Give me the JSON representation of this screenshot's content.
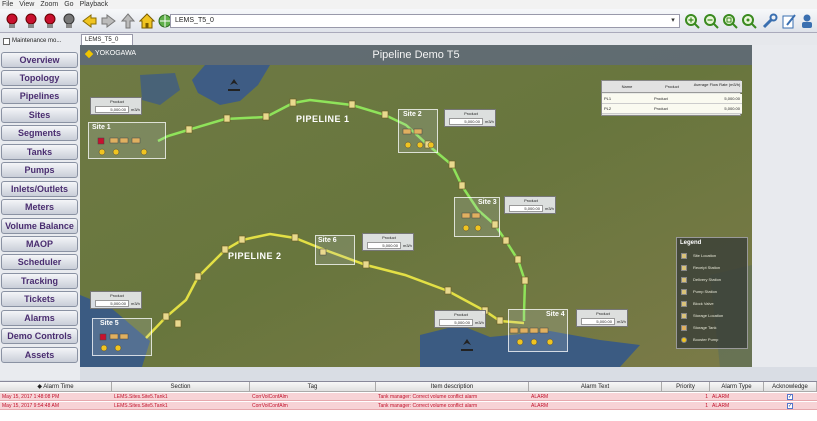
{
  "menu": [
    "File",
    "View",
    "Zoom",
    "Go",
    "Playback"
  ],
  "address": {
    "value": "LEMS_T5_0"
  },
  "tab": {
    "label": "LEMS_T5_0"
  },
  "sidebar": {
    "maintenance_label": "Maintenance mo...",
    "items": [
      "Overview",
      "Topology",
      "Pipelines",
      "Sites",
      "Segments",
      "Tanks",
      "Pumps",
      "Inlets/Outlets",
      "Meters",
      "Volume Balance",
      "MAOP",
      "Scheduler",
      "Tracking",
      "Tickets",
      "Alarms",
      "Demo Controls",
      "Assets"
    ]
  },
  "map": {
    "brand": "YOKOGAWA",
    "title": "Pipeline Demo T5",
    "pipelines": [
      "PIPELINE 1",
      "PIPELINE 2"
    ],
    "sites": [
      "Site 1",
      "Site 2",
      "Site 3",
      "Site 4",
      "Site 5",
      "Site 6"
    ],
    "panels": [
      {
        "label": "Product",
        "value": "5,000.00",
        "unit": "m3/h"
      },
      {
        "label": "Product",
        "value": "5,000.00",
        "unit": "m3/h"
      },
      {
        "label": "Product",
        "value": "5,000.00",
        "unit": "m3/h"
      },
      {
        "label": "Product",
        "value": "5,000.00",
        "unit": "m3/h"
      },
      {
        "label": "Product",
        "value": "5,000.00",
        "unit": "m3/h"
      },
      {
        "label": "Product",
        "value": "5,000.00",
        "unit": "m3/h"
      },
      {
        "label": "Product",
        "value": "5,000.00",
        "unit": "m3/h"
      }
    ],
    "summary": {
      "headers": [
        "Name",
        "Product",
        "Average Flow Rate (m3/h)"
      ],
      "rows": [
        {
          "name": "PL1",
          "product": "Product",
          "rate": "5,000.00"
        },
        {
          "name": "PL2",
          "product": "Product",
          "rate": "5,000.00"
        }
      ]
    },
    "legend": {
      "title": "Legend",
      "items": [
        "Site Location",
        "Receipt Station",
        "Delivery Station",
        "Pump Station",
        "Block Valve",
        "Storage Location",
        "Storage Tank",
        "Booster Pump"
      ]
    }
  },
  "alarms": {
    "headers": [
      "Alarm Time",
      "Section",
      "Tag",
      "Item description",
      "Alarm Text",
      "Priority",
      "Alarm Type",
      "Acknowledge"
    ],
    "rows": [
      {
        "time": "May 15, 2017 1:48:08 PM",
        "section": "LEMS.Sites.Site5.Tank1",
        "tag": "CorrVolConfAlm",
        "desc": "Tank manager: Correct volume conflict alarm",
        "text": "ALARM",
        "priority": "1",
        "type": "ALARM"
      },
      {
        "time": "May 15, 2017 9:54:48 AM",
        "section": "LEMS.Sites.Site5.Tank1",
        "tag": "CorrVolConfAlm",
        "desc": "Tank manager: Correct volume conflict alarm",
        "text": "ALARM",
        "priority": "1",
        "type": "ALARM"
      }
    ]
  },
  "colors": {
    "pipeline1": "#8fe35a",
    "pipeline2": "#e3e045",
    "nav_text": "#4a2d70",
    "alarm_text": "#c0102a",
    "alarm_row": "#f7d3d6"
  }
}
